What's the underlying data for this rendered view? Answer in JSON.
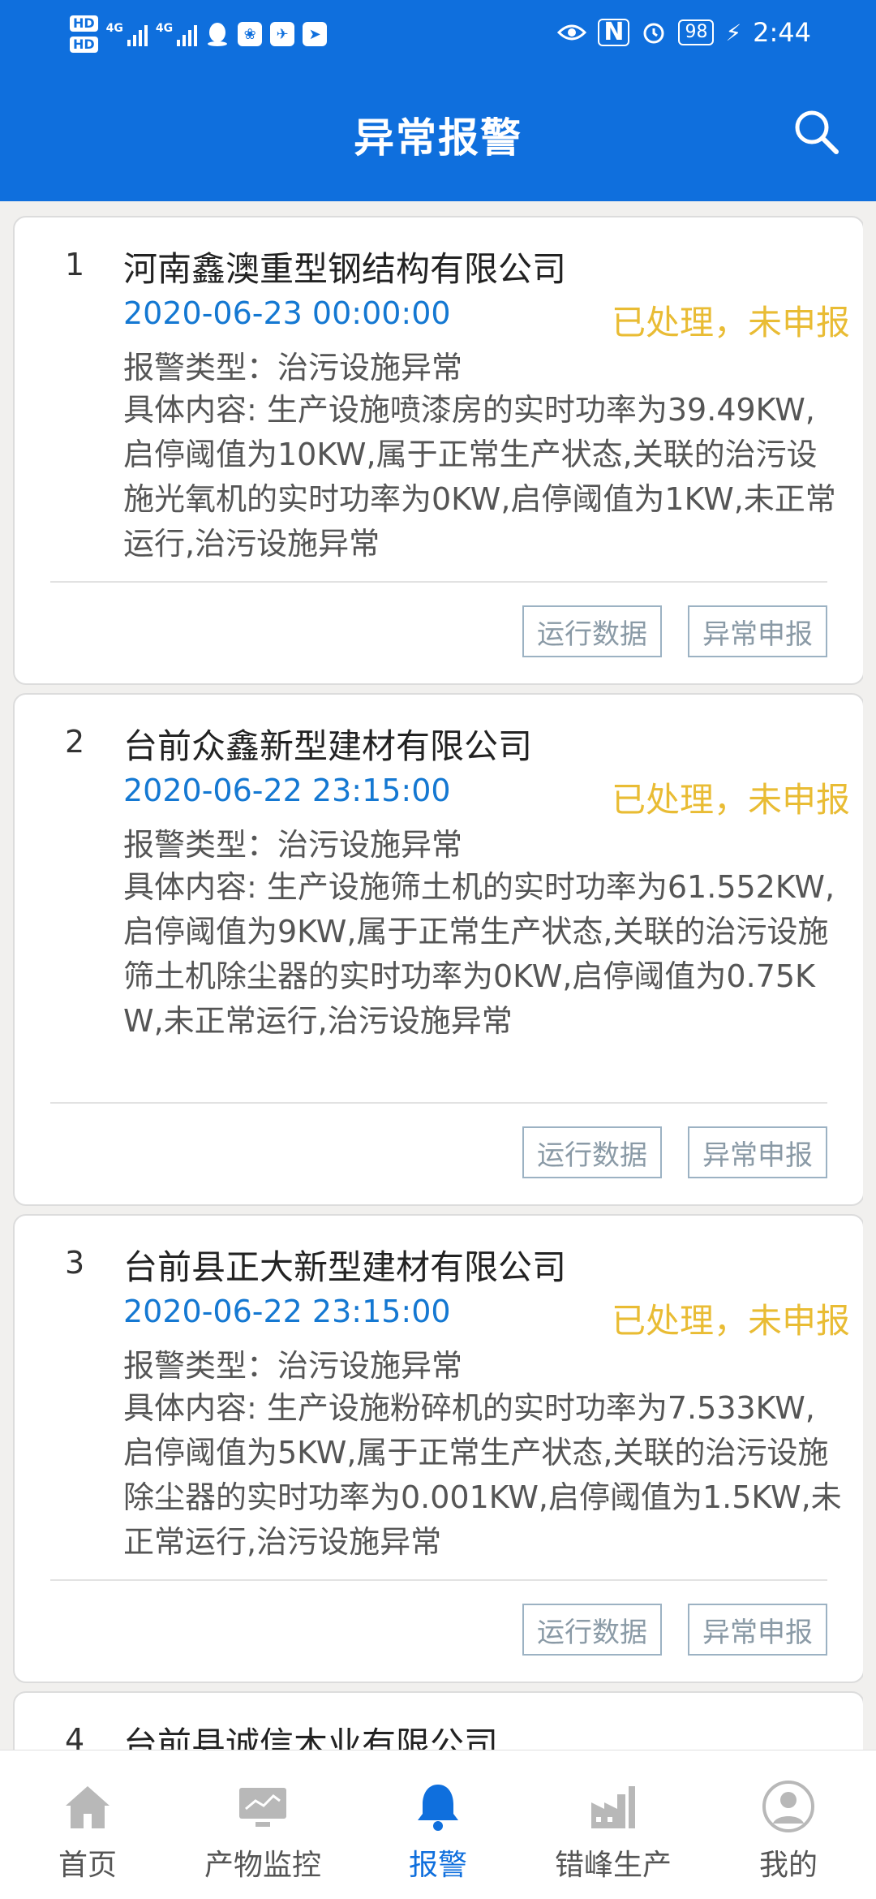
{
  "status_bar": {
    "time": "2:44",
    "battery": "98",
    "network_labels": [
      "4G",
      "4G"
    ],
    "hd_labels": [
      "HD",
      "HD"
    ]
  },
  "header": {
    "title": "异常报警"
  },
  "alarms": [
    {
      "index": "1",
      "company": "河南鑫澳重型钢结构有限公司",
      "time": "2020-06-23 00:00:00",
      "status": "已处理，未申报",
      "type": "报警类型：治污设施异常",
      "content": "具体内容: 生产设施喷漆房的实时功率为39.49KW,启停阈值为10KW,属于正常生产状态,关联的治污设施光氧机的实时功率为0KW,启停阈值为1KW,未正常运行,治污设施异常",
      "btn_run": "运行数据",
      "btn_report": "异常申报"
    },
    {
      "index": "2",
      "company": "台前众鑫新型建材有限公司",
      "time": "2020-06-22 23:15:00",
      "status": "已处理，未申报",
      "type": "报警类型：治污设施异常",
      "content": "具体内容: 生产设施筛土机的实时功率为61.552KW,启停阈值为9KW,属于正常生产状态,关联的治污设施筛土机除尘器的实时功率为0KW,启停阈值为0.75KW,未正常运行,治污设施异常",
      "btn_run": "运行数据",
      "btn_report": "异常申报"
    },
    {
      "index": "3",
      "company": "台前县正大新型建材有限公司",
      "time": "2020-06-22 23:15:00",
      "status": "已处理，未申报",
      "type": "报警类型：治污设施异常",
      "content": "具体内容: 生产设施粉碎机的实时功率为7.533KW,启停阈值为5KW,属于正常生产状态,关联的治污设施除尘器的实时功率为0.001KW,启停阈值为1.5KW,未正常运行,治污设施异常",
      "btn_run": "运行数据",
      "btn_report": "异常申报"
    },
    {
      "index": "4",
      "company": "台前县诚信木业有限公司"
    }
  ],
  "nav": [
    {
      "label": "首页",
      "icon": "home-icon"
    },
    {
      "label": "产物监控",
      "icon": "monitor-icon"
    },
    {
      "label": "报警",
      "icon": "bell-icon"
    },
    {
      "label": "错峰生产",
      "icon": "factory-icon"
    },
    {
      "label": "我的",
      "icon": "user-icon"
    }
  ],
  "colors": {
    "primary": "#0f6fdd",
    "status_yellow": "#e9bc34",
    "time_blue": "#1478d2",
    "nav_inactive": "#b8b8b8"
  }
}
